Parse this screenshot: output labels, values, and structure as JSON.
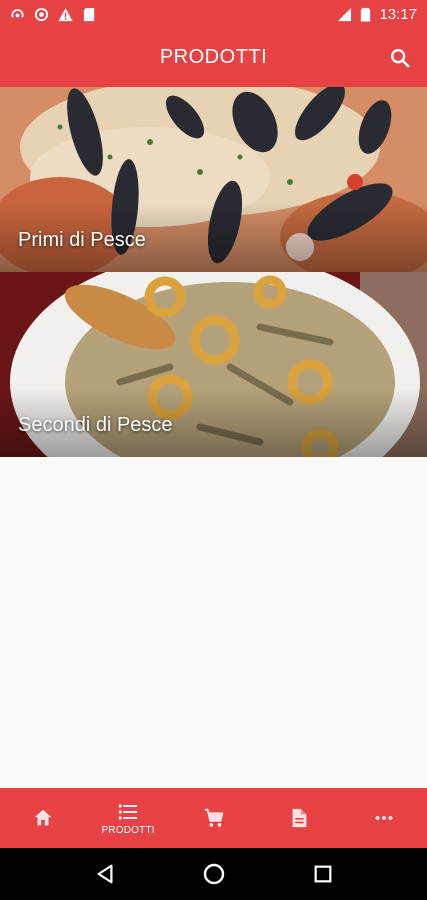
{
  "status_bar": {
    "time": "13:17",
    "icons_left": [
      "podcast-icon",
      "location-icon",
      "warning-icon",
      "sd-card-icon"
    ],
    "icons_right": [
      "signal-icon",
      "battery-icon"
    ]
  },
  "app_bar": {
    "title": "PRODOTTI",
    "search_icon": "search-icon"
  },
  "categories": [
    {
      "label": "Primi di Pesce",
      "image": "seafood-risotto-photo"
    },
    {
      "label": "Secondi di Pesce",
      "image": "fried-seafood-photo"
    }
  ],
  "bottom_nav": {
    "items": [
      {
        "icon": "home-icon",
        "label": ""
      },
      {
        "icon": "list-icon",
        "label": "PRODOTTI",
        "active": true
      },
      {
        "icon": "cart-icon",
        "label": ""
      },
      {
        "icon": "document-icon",
        "label": ""
      },
      {
        "icon": "more-icon",
        "label": ""
      }
    ]
  },
  "colors": {
    "primary": "#e74345",
    "background": "#fafafa",
    "system_nav": "#000000"
  }
}
